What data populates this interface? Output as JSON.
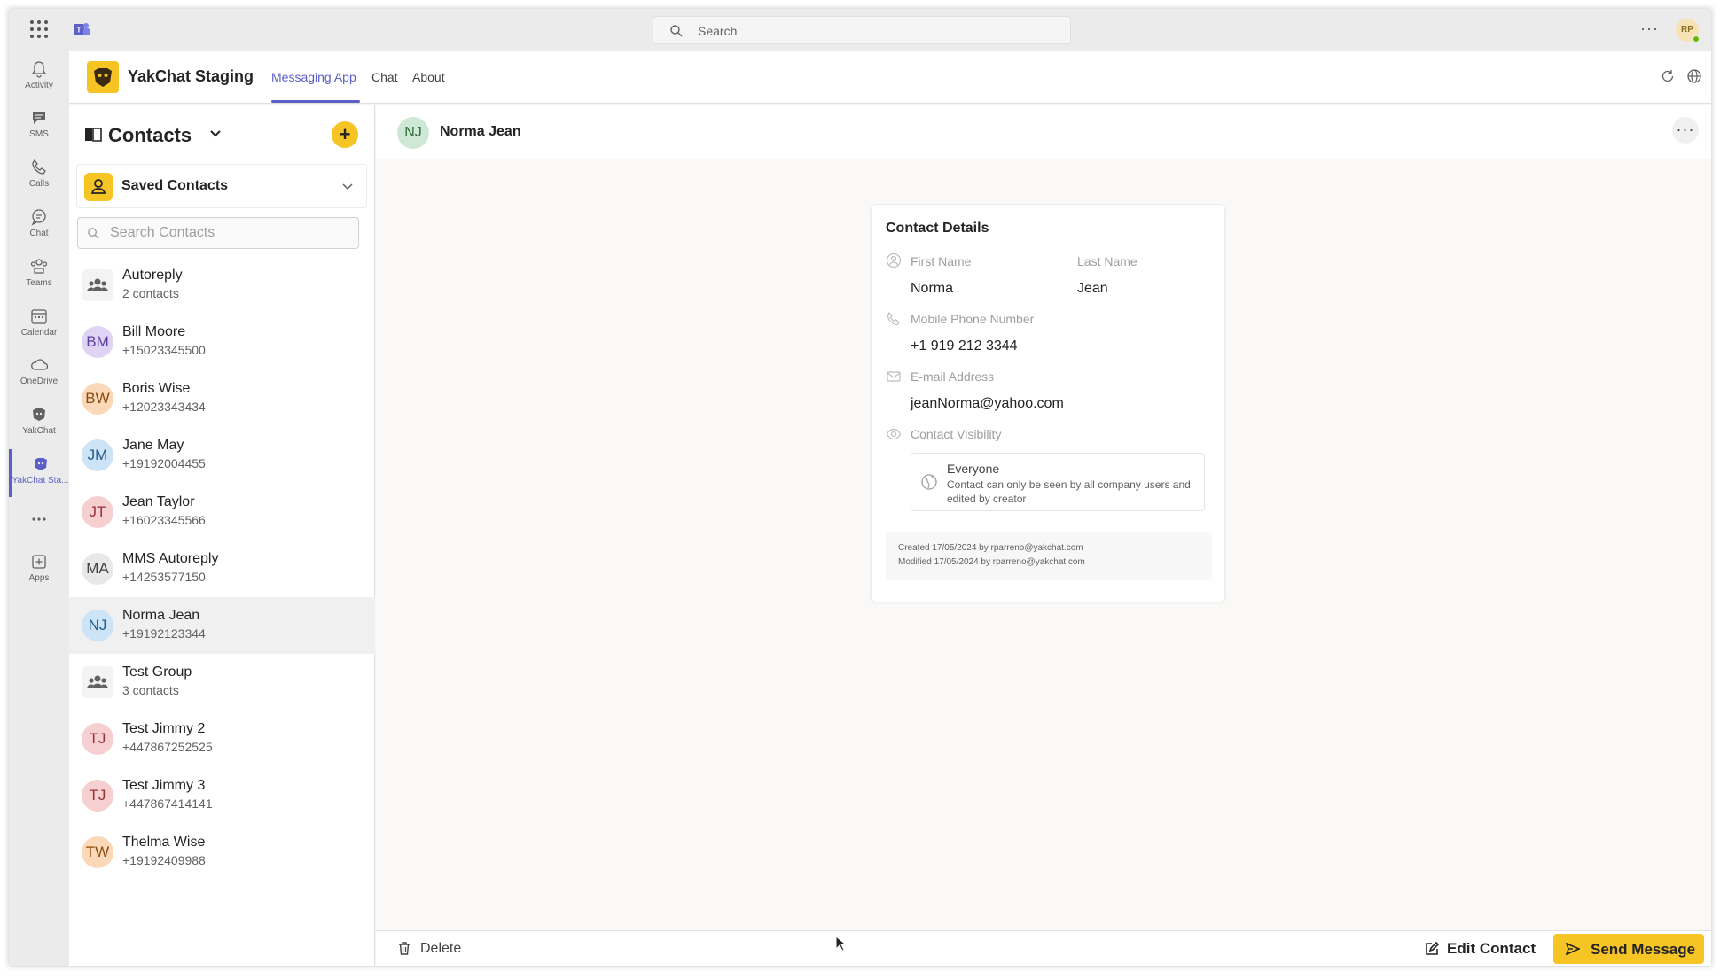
{
  "topbar": {
    "search_placeholder": "Search",
    "more": "···",
    "avatar_initials": "RP"
  },
  "rail": {
    "items": [
      {
        "label": "Activity",
        "icon": "bell-icon"
      },
      {
        "label": "SMS",
        "icon": "sms-icon"
      },
      {
        "label": "Calls",
        "icon": "phone-icon"
      },
      {
        "label": "Chat",
        "icon": "chat-icon"
      },
      {
        "label": "Teams",
        "icon": "teams-icon"
      },
      {
        "label": "Calendar",
        "icon": "calendar-icon"
      },
      {
        "label": "OneDrive",
        "icon": "cloud-icon"
      },
      {
        "label": "YakChat",
        "icon": "yakchat-icon"
      },
      {
        "label": "YakChat Sta...",
        "icon": "yakchat-icon",
        "active": true
      },
      {
        "label": "",
        "icon": "more-icon"
      },
      {
        "label": "Apps",
        "icon": "apps-plus-icon"
      }
    ]
  },
  "app_header": {
    "title": "YakChat Staging",
    "tabs": [
      {
        "label": "Messaging App",
        "active": true
      },
      {
        "label": "Chat",
        "active": false
      },
      {
        "label": "About",
        "active": false
      }
    ]
  },
  "contacts_panel": {
    "title": "Contacts",
    "add_label": "+",
    "saved_contacts_label": "Saved Contacts",
    "search_placeholder": "Search Contacts",
    "contacts": [
      {
        "name": "Autoreply",
        "sub": "2 contacts",
        "initials": "",
        "group": true,
        "bg": "#f3f3f3",
        "fg": "#616161"
      },
      {
        "name": "Bill Moore",
        "sub": "+15023345500",
        "initials": "BM",
        "group": false,
        "bg": "#e0d4f5",
        "fg": "#5c3d99"
      },
      {
        "name": "Boris Wise",
        "sub": "+12023343434",
        "initials": "BW",
        "group": false,
        "bg": "#fbd9b8",
        "fg": "#8a4b12"
      },
      {
        "name": "Jane May",
        "sub": "+19192004455",
        "initials": "JM",
        "group": false,
        "bg": "#cde4f7",
        "fg": "#1f5c8f"
      },
      {
        "name": "Jean Taylor",
        "sub": "+16023345566",
        "initials": "JT",
        "group": false,
        "bg": "#f6cfd1",
        "fg": "#9a3239"
      },
      {
        "name": "MMS Autoreply",
        "sub": "+14253577150",
        "initials": "MA",
        "group": false,
        "bg": "#e8e8e8",
        "fg": "#424242"
      },
      {
        "name": "Norma Jean",
        "sub": "+19192123344",
        "initials": "NJ",
        "group": false,
        "selected": true,
        "bg": "#cde4f7",
        "fg": "#1f5c8f"
      },
      {
        "name": "Test Group",
        "sub": "3 contacts",
        "initials": "",
        "group": true,
        "bg": "#f3f3f3",
        "fg": "#616161"
      },
      {
        "name": "Test Jimmy 2",
        "sub": "+447867252525",
        "initials": "TJ",
        "group": false,
        "bg": "#f6cfd1",
        "fg": "#9a3239"
      },
      {
        "name": "Test Jimmy 3",
        "sub": "+447867414141",
        "initials": "TJ",
        "group": false,
        "bg": "#f6cfd1",
        "fg": "#9a3239"
      },
      {
        "name": "Thelma Wise",
        "sub": "+19192409988",
        "initials": "TW",
        "group": false,
        "bg": "#fbd9b8",
        "fg": "#8a4b12"
      }
    ]
  },
  "main": {
    "header": {
      "initials": "NJ",
      "name": "Norma Jean",
      "more": "···"
    },
    "card": {
      "title": "Contact Details",
      "first_name_label": "First Name",
      "first_name": "Norma",
      "last_name_label": "Last Name",
      "last_name": "Jean",
      "phone_label": "Mobile Phone Number",
      "phone": "+1 919 212 3344",
      "email_label": "E-mail Address",
      "email": "jeanNorma@yahoo.com",
      "visibility_label": "Contact Visibility",
      "visibility_title": "Everyone",
      "visibility_desc": "Contact can only be seen by all company users and edited by creator",
      "created": "Created 17/05/2024 by rparreno@yakchat.com",
      "modified": "Modified 17/05/2024 by rparreno@yakchat.com"
    },
    "bottom": {
      "delete_label": "Delete",
      "edit_label": "Edit Contact",
      "send_label": "Send Message"
    }
  },
  "colors": {
    "accent": "#5b5fc7",
    "brand_yellow": "#f6c524"
  }
}
